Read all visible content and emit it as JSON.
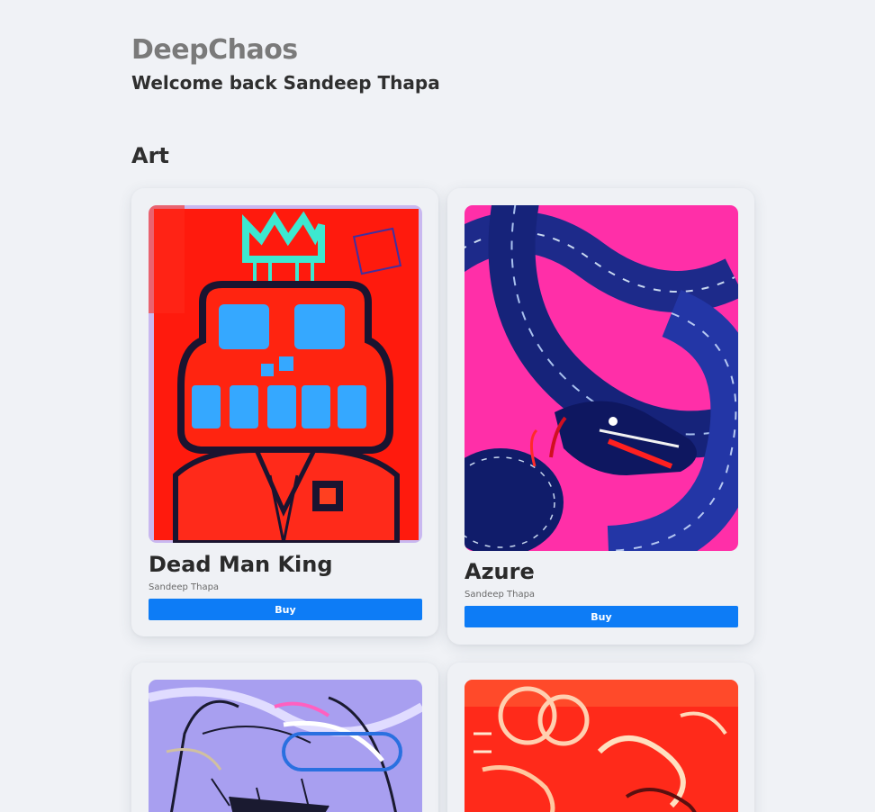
{
  "header": {
    "brand": "DeepChaos",
    "welcome": "Welcome back Sandeep Thapa"
  },
  "section": {
    "title": "Art"
  },
  "cards": [
    {
      "title": "Dead Man King",
      "artist": "Sandeep Thapa",
      "buy_label": "Buy",
      "image": "dead-man-king-painting"
    },
    {
      "title": "Azure",
      "artist": "Sandeep Thapa",
      "buy_label": "Buy",
      "image": "azure-serpent-painting"
    },
    {
      "title": "",
      "artist": "",
      "buy_label": "",
      "image": "graffiti-face-painting"
    },
    {
      "title": "",
      "artist": "",
      "buy_label": "",
      "image": "red-graffiti-painting"
    }
  ],
  "colors": {
    "background": "#f0f2f6",
    "card": "#eff1f5",
    "button": "#0d7cf6",
    "brand_text": "#7a7a7a"
  }
}
